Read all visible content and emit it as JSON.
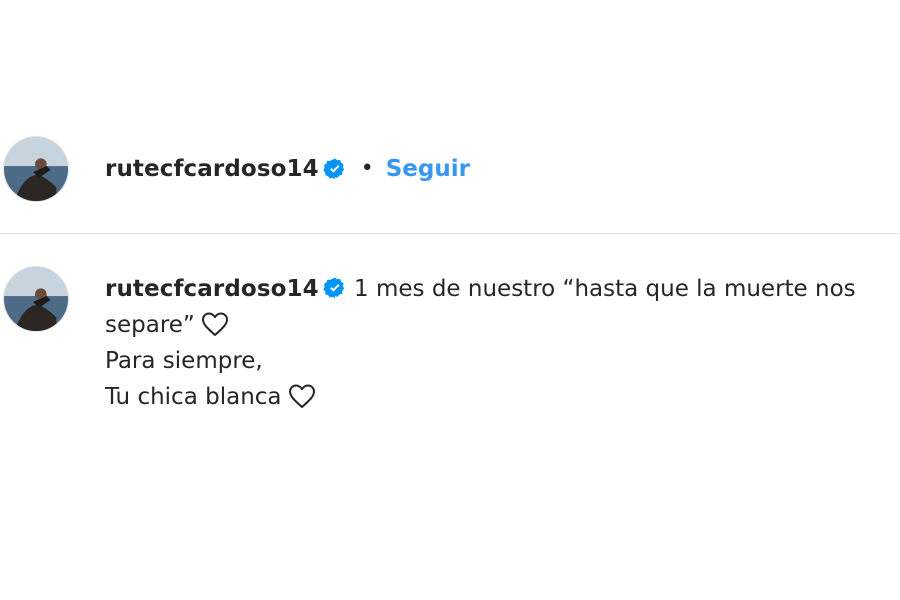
{
  "post_header": {
    "username": "rutecfcardoso14",
    "verified_icon": "verified-badge-icon",
    "separator": "•",
    "follow_label": "Seguir"
  },
  "caption": {
    "username": "rutecfcardoso14",
    "verified_icon": "verified-badge-icon",
    "text_line_1": "1 mes de nuestro “hasta que la muerte nos",
    "text_line_2": "separe”",
    "text_line_3": "Para siempre,",
    "text_line_4": "Tu chica blanca",
    "heart_icon": "heart-outline-icon"
  },
  "colors": {
    "accent": "#3897f0",
    "verified": "#0095f6",
    "text": "#262626"
  }
}
